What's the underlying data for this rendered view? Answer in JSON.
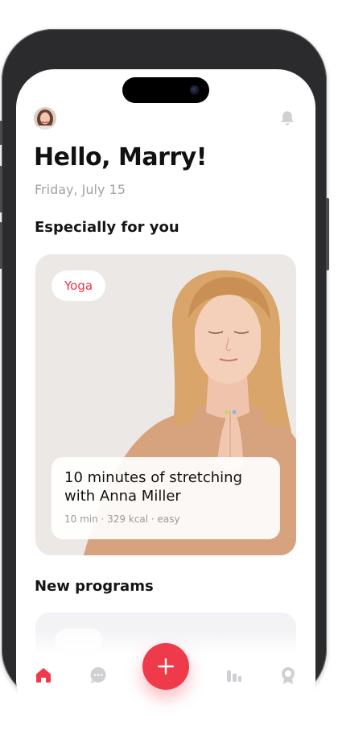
{
  "header": {
    "greeting": "Hello, Marry!",
    "date": "Friday, July 15"
  },
  "sections": {
    "featured_title": "Especially for you",
    "new_title": "New programs"
  },
  "featured_card": {
    "tag": "Yoga",
    "title": "10 minutes of stretching with Anna Miller",
    "meta": "10 min · 329 kcal · easy"
  },
  "nav": {
    "items": [
      "home-icon",
      "chat-icon",
      "add-icon",
      "stats-icon",
      "award-icon"
    ],
    "active": "home-icon"
  },
  "colors": {
    "accent": "#ef3a4c",
    "muted": "#a3a3a8",
    "icon_inactive": "#d0d0d4"
  }
}
